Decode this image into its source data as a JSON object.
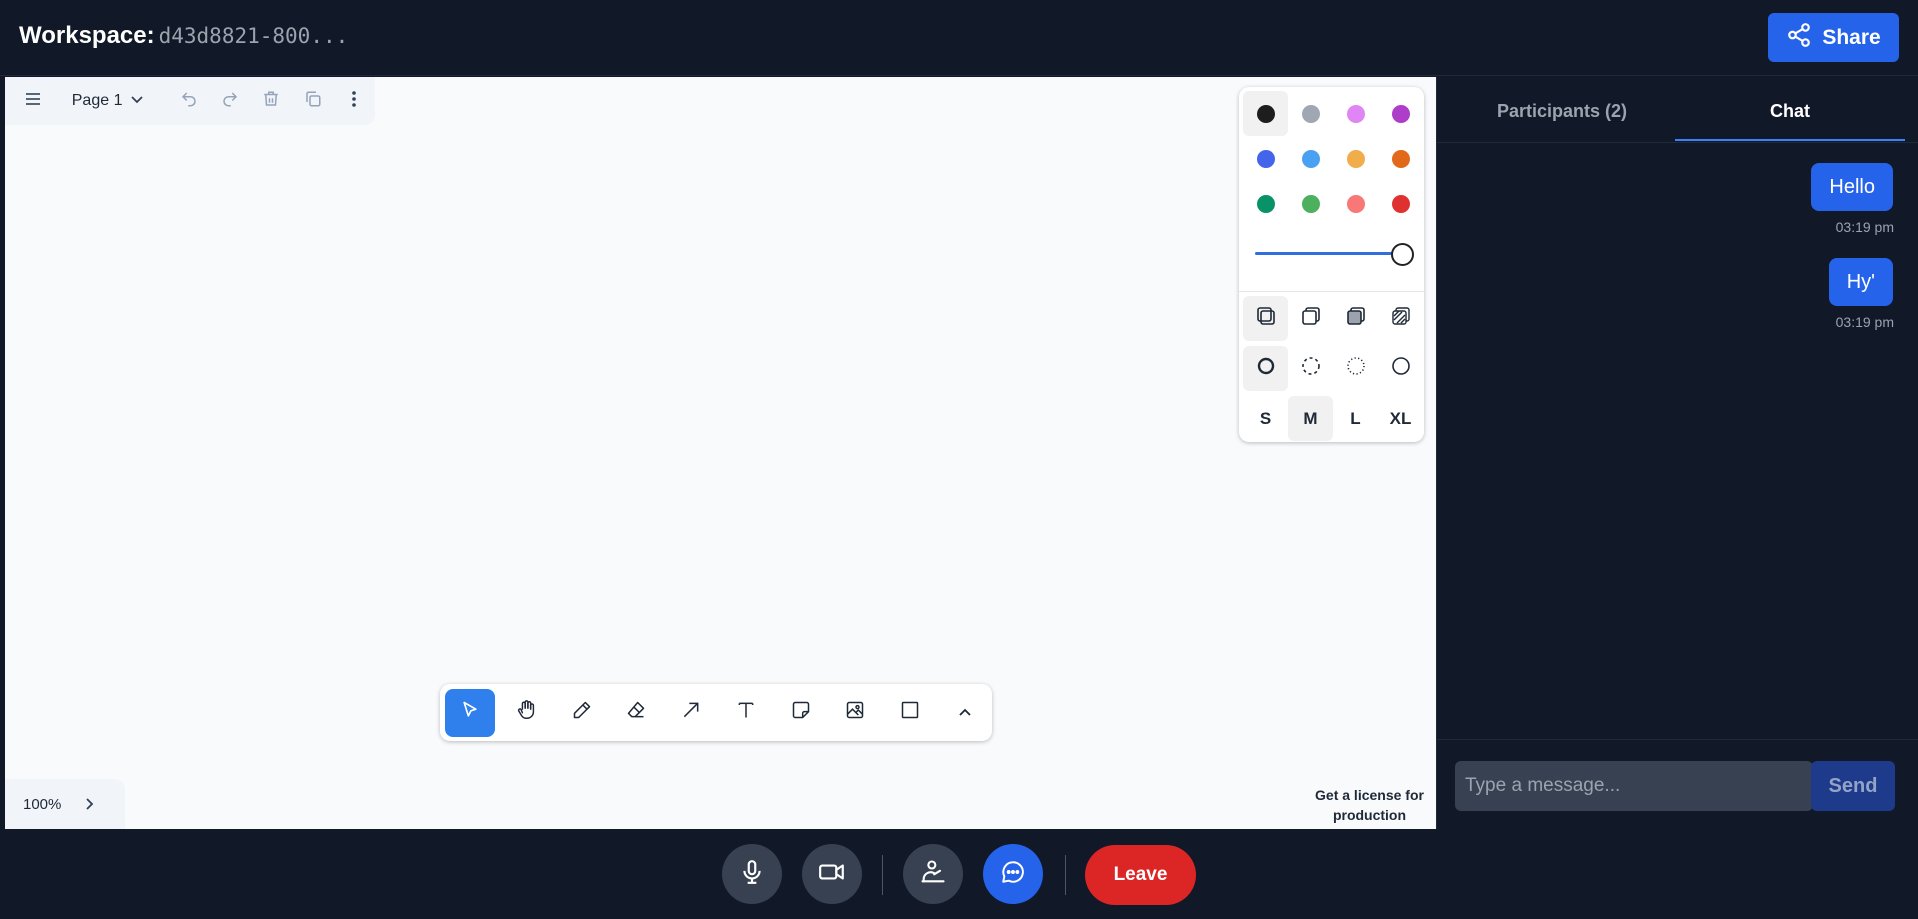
{
  "header": {
    "workspace_label": "Workspace:",
    "workspace_id": "d43d8821-800...",
    "share_label": "Share"
  },
  "canvas_toolbar": {
    "page_label": "Page 1",
    "icons": [
      "menu-icon",
      "chevron-down-icon",
      "undo-icon",
      "redo-icon",
      "trash-icon",
      "duplicate-icon",
      "more-vertical-icon"
    ]
  },
  "style_panel": {
    "colors": [
      {
        "name": "black",
        "hex": "#1d1d1d",
        "selected": true
      },
      {
        "name": "grey",
        "hex": "#9fa8b2"
      },
      {
        "name": "light-violet",
        "hex": "#e085f4"
      },
      {
        "name": "violet",
        "hex": "#ae3ec9"
      },
      {
        "name": "blue",
        "hex": "#4465e9"
      },
      {
        "name": "light-blue",
        "hex": "#4ba1f1"
      },
      {
        "name": "yellow",
        "hex": "#f1ac4b"
      },
      {
        "name": "orange",
        "hex": "#e16919"
      },
      {
        "name": "green",
        "hex": "#099268"
      },
      {
        "name": "light-green",
        "hex": "#4cb05e"
      },
      {
        "name": "light-red",
        "hex": "#f87777"
      },
      {
        "name": "red",
        "hex": "#e03131"
      }
    ],
    "opacity": 1.0,
    "fill_options": [
      "fill-none-icon",
      "fill-semi-icon",
      "fill-solid-icon",
      "fill-pattern-icon"
    ],
    "dash_options": [
      "dash-draw-icon",
      "dash-dashed-icon",
      "dash-dotted-icon",
      "dash-solid-icon"
    ],
    "sizes": [
      "S",
      "M",
      "L",
      "XL"
    ],
    "selected_size": "M"
  },
  "tools": [
    "select-tool-icon",
    "hand-tool-icon",
    "draw-tool-icon",
    "eraser-tool-icon",
    "arrow-tool-icon",
    "text-tool-icon",
    "note-tool-icon",
    "image-tool-icon",
    "rectangle-tool-icon",
    "more-tools-icon"
  ],
  "zoom": {
    "value": "100%"
  },
  "license": {
    "line1": "Get a license for",
    "line2": "production"
  },
  "panel": {
    "tab_participants": "Participants (2)",
    "tab_chat": "Chat",
    "messages": [
      {
        "text": "Hello",
        "time": "03:19 pm"
      },
      {
        "text": "Hy'",
        "time": "03:19 pm"
      }
    ],
    "input_placeholder": "Type a message...",
    "send_label": "Send"
  },
  "controls": {
    "leave_label": "Leave",
    "colors": {
      "accent": "#2563eb",
      "danger": "#dc2626",
      "background": "#111827"
    }
  }
}
